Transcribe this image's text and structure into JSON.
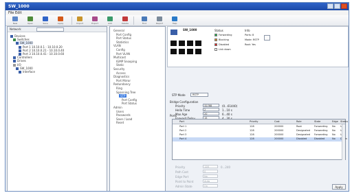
{
  "window": {
    "title": "SW_1000"
  },
  "menubar": {
    "label": "File  Edit"
  },
  "toolbar": {
    "items": [
      "New",
      "Open",
      "Save",
      "Apply",
      "Import",
      "Export",
      "Add",
      "Delete",
      "Find",
      "Report",
      "Help"
    ]
  },
  "tree": {
    "filter_label": "Network",
    "items": [
      "Devices",
      "Switches",
      "SW_1000",
      "Port 1  10.10.0.1 - 10.10.0.20",
      "Port 2  10.10.0.21 - 10.10.0.40",
      "Port 3  10.10.0.41 - 10.10.0.60",
      "Controllers",
      "Drives",
      "I/O",
      "SW_1000",
      "Interface"
    ]
  },
  "nav": {
    "items": [
      "General",
      "Port Config",
      "Port Status",
      "Statistics",
      "VLAN",
      "Config",
      "Port VLAN",
      "Multicast",
      "IGMP Snooping",
      "Static",
      "Security",
      "Access",
      "Diagnostics",
      "Port Mirror",
      "Redundancy",
      "Ring",
      "Spanning Tree",
      "STP",
      "Port Config",
      "Port Status",
      "Admin",
      "Users",
      "Passwords",
      "Save / Load",
      "Reset"
    ],
    "selected_index": 17
  },
  "switch": {
    "header": "SW_1000",
    "status_title": "Status",
    "legend": [
      "Forwarding",
      "Blocking",
      "Disabled",
      "Link down"
    ],
    "legend_colors": [
      "#1db34a",
      "#e08a1a",
      "#e02020",
      "#ffffff"
    ],
    "info_title": "Info",
    "info": [
      "Ports: 8",
      "Mode: RSTP",
      "Root: Yes"
    ]
  },
  "stp": {
    "mode_label": "STP Mode",
    "mode_value": "RSTP",
    "section_title": "Bridge Configuration",
    "fields": [
      {
        "label": "Priority",
        "value": "32768",
        "unit": "(0...61440)"
      },
      {
        "label": "Hello Time",
        "value": "2",
        "unit": "1...10 s"
      },
      {
        "label": "Max Age",
        "value": "20",
        "unit": "6...40 s"
      },
      {
        "label": "Forward Delay",
        "value": "15",
        "unit": "4...30 s"
      }
    ],
    "ports_title": "Ports",
    "columns": [
      "Port",
      "Priority",
      "Cost",
      "Role",
      "State",
      "Edge",
      "Status"
    ],
    "rows": [
      [
        "Port 1",
        "128",
        "200000",
        "Root",
        "Forwarding",
        "No",
        "Up"
      ],
      [
        "Port 2",
        "128",
        "200000",
        "Designated",
        "Forwarding",
        "No",
        "Up"
      ],
      [
        "Port 3",
        "128",
        "200000",
        "Designated",
        "Forwarding",
        "No",
        "Up"
      ],
      [
        "Port 4",
        "128",
        "200000",
        "Disabled",
        "Disabled",
        "No",
        "Down"
      ]
    ],
    "selected_row": 3,
    "port_fields": [
      {
        "label": "Priority",
        "value": "128",
        "unit": "0...240"
      },
      {
        "label": "Path Cost",
        "value": "0",
        "unit": ""
      },
      {
        "label": "Edge Port",
        "value": "No",
        "unit": ""
      },
      {
        "label": "Point to Point",
        "value": "Auto",
        "unit": ""
      },
      {
        "label": "Admin State",
        "value": "On",
        "unit": ""
      }
    ],
    "apply_label": "Apply"
  }
}
